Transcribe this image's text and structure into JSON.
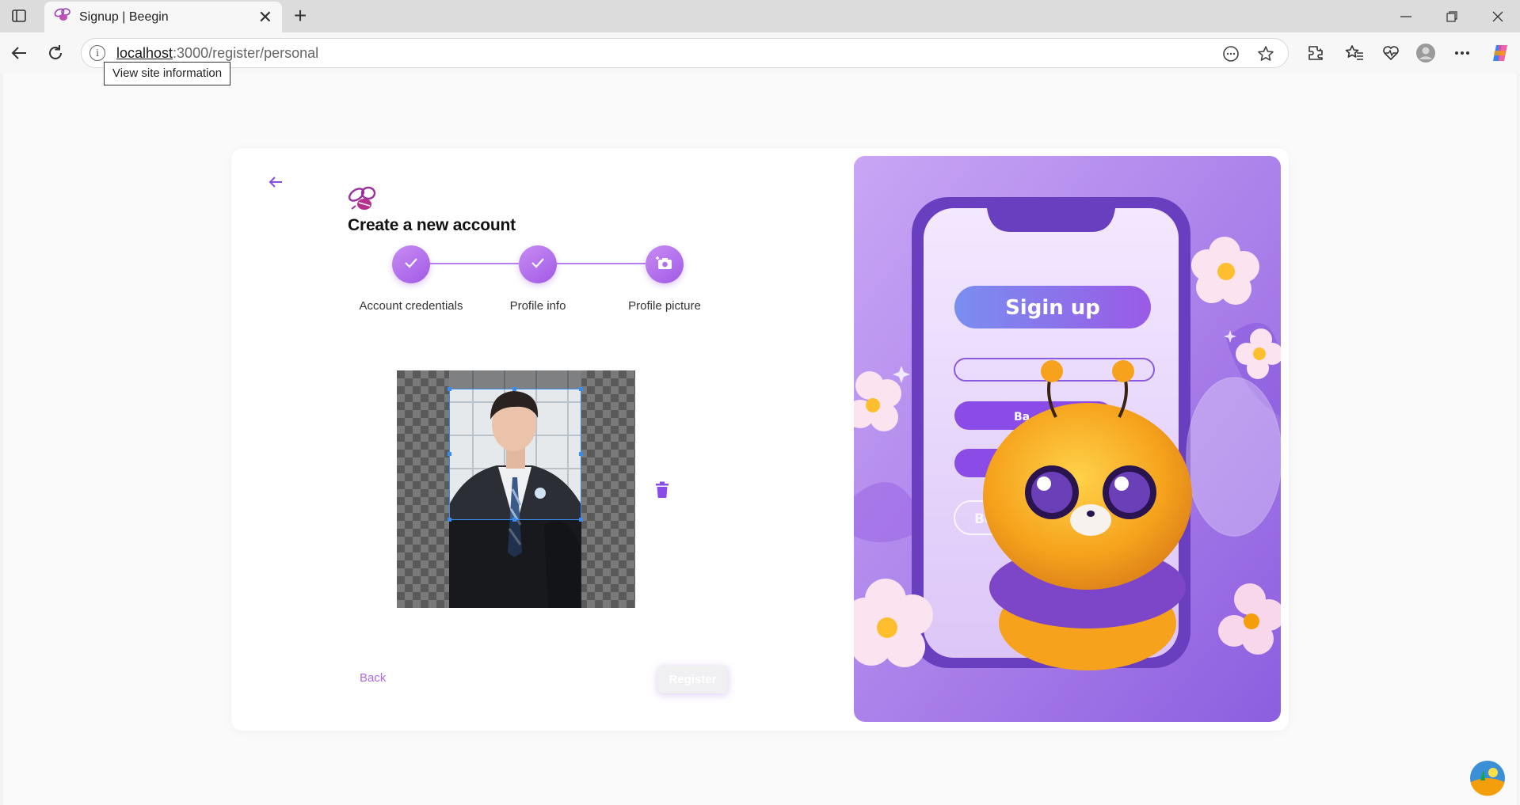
{
  "browser": {
    "tab_title": "Signup | Beegin",
    "url_host": "localhost",
    "url_path": ":3000/register/personal",
    "tooltip": "View site information"
  },
  "page": {
    "title": "Create a new account",
    "steps": [
      {
        "label": "Account credentials",
        "state": "completed"
      },
      {
        "label": "Profile info",
        "state": "completed"
      },
      {
        "label": "Profile picture",
        "state": "current"
      }
    ],
    "back_label": "Back",
    "register_label": "Register"
  },
  "illustration": {
    "headline": "Sigin up",
    "button_fragment_1": "Ba",
    "button_fragment_2": "Bee"
  },
  "colors": {
    "accent": "#a15ae6",
    "link": "#b06adf",
    "illustration_bg": "#b88cf0"
  }
}
